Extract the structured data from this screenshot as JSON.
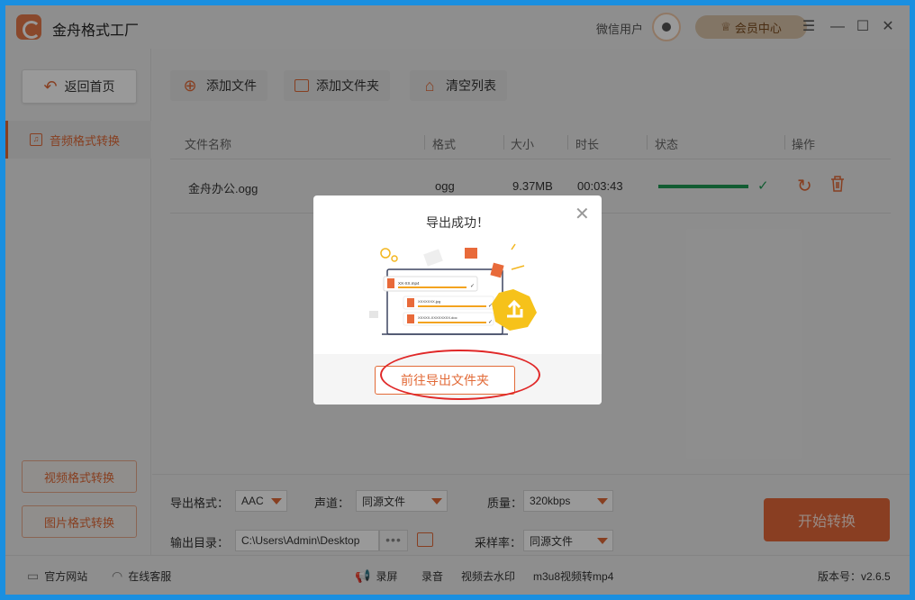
{
  "app": {
    "title": "金舟格式工厂"
  },
  "user": {
    "name": "微信用户",
    "vip_label": "会员中心"
  },
  "window_controls": {
    "menu": "☰",
    "minimize": "—",
    "maximize": "☐",
    "close": "✕"
  },
  "sidebar": {
    "back_label": "返回首页",
    "active_item": "音频格式转换",
    "other_items": [
      "视频格式转换",
      "图片格式转换"
    ]
  },
  "toolbar": {
    "add_file": "添加文件",
    "add_folder": "添加文件夹",
    "clear_list": "清空列表"
  },
  "table": {
    "headers": [
      "文件名称",
      "格式",
      "大小",
      "时长",
      "状态",
      "操作"
    ],
    "rows": [
      {
        "name": "金舟办公.ogg",
        "format": "ogg",
        "size": "9.37MB",
        "duration": "00:03:43",
        "progress": 1.0
      }
    ]
  },
  "settings": {
    "format_label": "导出格式：",
    "format_value": "AAC",
    "channel_label": "声道：",
    "channel_value": "同源文件",
    "quality_label": "质量：",
    "quality_value": "320kbps",
    "output_label": "输出目录：",
    "output_value": "C:\\Users\\Admin\\Desktop",
    "sample_label": "采样率：",
    "sample_value": "同源文件",
    "start_label": "开始转换"
  },
  "statusbar": {
    "website": "官方网站",
    "service": "在线客服",
    "record_screen": "录屏",
    "record_audio": "录音",
    "remove_watermark": "视频去水印",
    "m3u8": "m3u8视频转mp4",
    "version": "版本号：v2.6.5"
  },
  "dialog": {
    "title": "导出成功！",
    "goto_label": "前往导出文件夹",
    "illus_files": [
      "XX-XX.mp4",
      "XXXXXXX.jpg",
      "XXXXX-XXXXXXXX.doc"
    ]
  },
  "colors": {
    "accent": "#e26a37",
    "success": "#1f9a54",
    "annotation": "#e02828"
  }
}
